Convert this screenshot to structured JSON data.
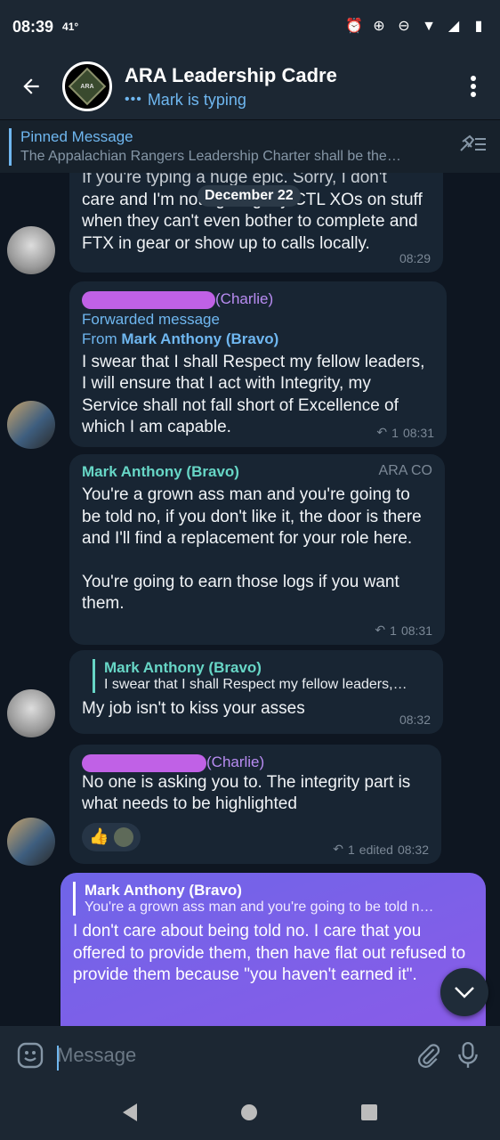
{
  "status_bar": {
    "time": "08:39",
    "temp": "41°"
  },
  "header": {
    "title": "ARA Leadership Cadre",
    "subtitle": "Mark is typing",
    "avatar_text": "ARA"
  },
  "pinned": {
    "title": "Pinned Message",
    "body": "The Appalachian Rangers Leadership Charter shall be the…"
  },
  "date_chip": "December 22",
  "messages": [
    {
      "text_top": "If you're typing a huge epic. Sorry, I don't",
      "text": "care and I'm not fighting my CTL XOs on stuff when they can't even bother to complete and FTX in gear or show up to calls locally.",
      "time": "08:29"
    },
    {
      "sender": "(Charlie)",
      "forwarded": "Forwarded message",
      "from_prefix": "From",
      "from_name": "Mark Anthony (Bravo)",
      "text": "I swear that I shall Respect my fellow leaders, I will ensure that I act with Integrity, my Service shall not fall short of Excellence of which I am capable.",
      "replies": "1",
      "time": "08:31"
    },
    {
      "sender": "Mark Anthony (Bravo)",
      "role": "ARA CO",
      "text_p1": "You're a grown ass man and you're going to be told no, if you don't like it, the door is there and I'll find a replacement for your role here.",
      "text_p2": "You're going to earn those logs if you want them.",
      "replies": "1",
      "time": "08:31"
    },
    {
      "quote_name": "Mark Anthony (Bravo)",
      "quote_text": "I swear that I shall Respect my fellow leaders,…",
      "text": "My job isn't to kiss your asses",
      "time": "08:32"
    },
    {
      "sender": "(Charlie)",
      "text": "No one is asking you to. The integrity part is what needs to be highlighted",
      "reaction_emoji": "👍",
      "replies": "1",
      "edited": "edited",
      "time": "08:32"
    },
    {
      "quote_name": "Mark Anthony (Bravo)",
      "quote_text": "You're a grown ass man and you're going to be told n…",
      "text": "I don't care about being told no. I care that you offered to provide them, then have flat out refused to provide them because \"you haven't earned it\"."
    }
  ],
  "input": {
    "placeholder": "Message"
  },
  "colors": {
    "accent": "#6fb7f0",
    "outgoing_bubble": "#7a60e8",
    "incoming_bubble": "#182533"
  }
}
